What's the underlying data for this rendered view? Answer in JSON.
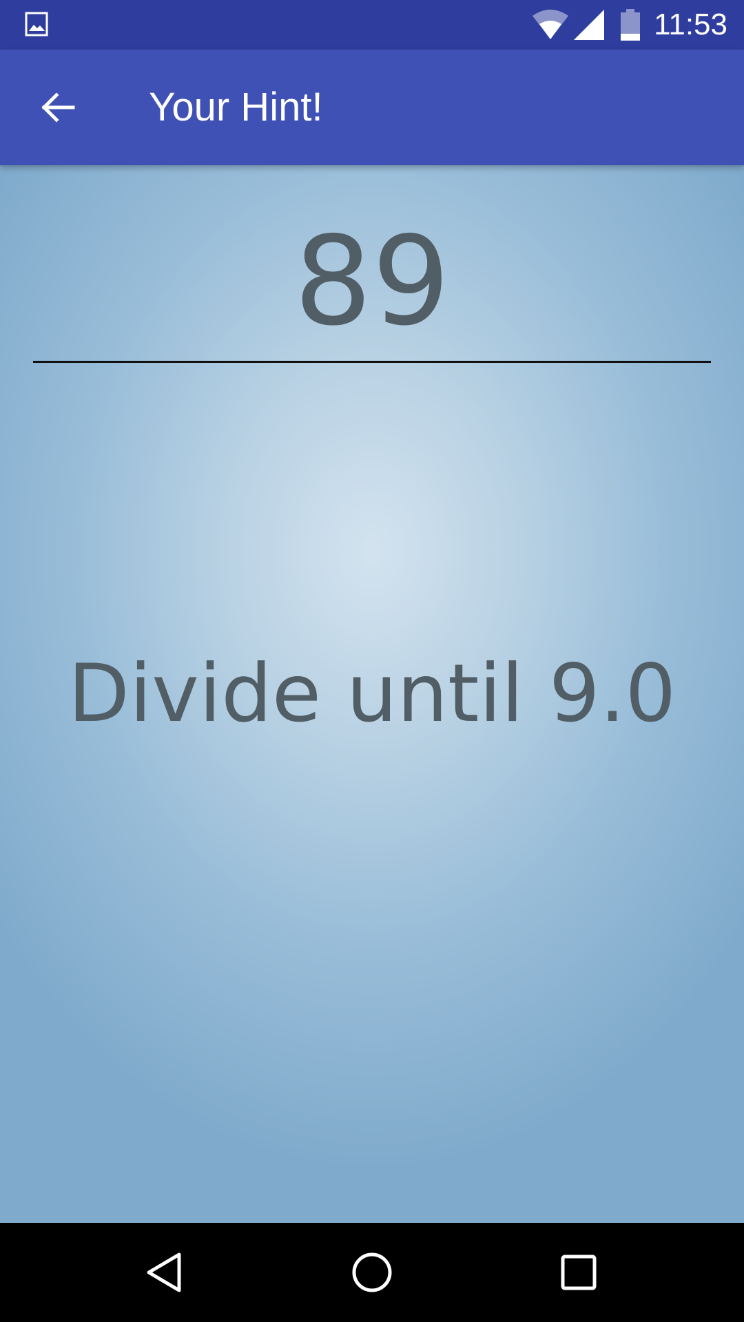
{
  "status_bar": {
    "time": "11:53",
    "icons": [
      "image-icon",
      "wifi-icon",
      "signal-icon",
      "battery-icon"
    ],
    "background_color": "#2f3e9e"
  },
  "app_bar": {
    "title": "Your Hint!",
    "back_icon": "arrow-left-icon",
    "background_color": "#3f51b5"
  },
  "content": {
    "number": "89",
    "hint": "Divide until 9.0",
    "text_color": "#515e66"
  },
  "nav_bar": {
    "buttons": [
      "back-triangle-icon",
      "home-circle-icon",
      "recents-square-icon"
    ]
  }
}
